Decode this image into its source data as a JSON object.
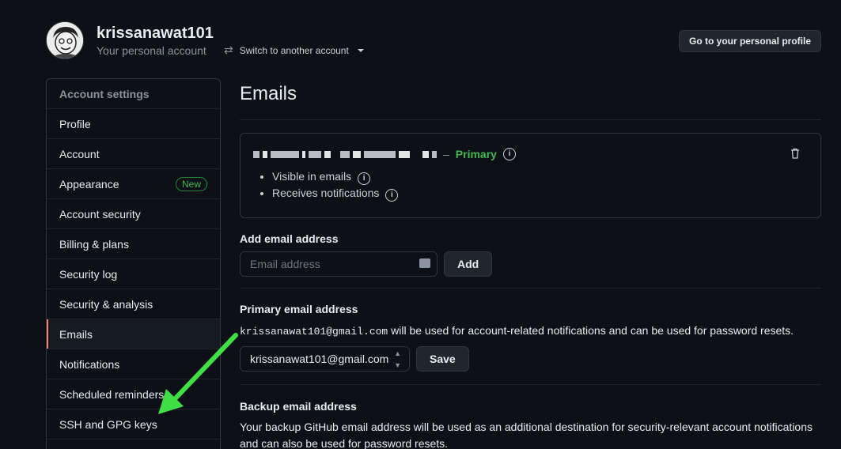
{
  "header": {
    "username": "krissanawat101",
    "subtitle": "Your personal account",
    "switch_label": "Switch to another account",
    "profile_button": "Go to your personal profile"
  },
  "sidebar": {
    "items": [
      {
        "label": "Account settings"
      },
      {
        "label": "Profile"
      },
      {
        "label": "Account"
      },
      {
        "label": "Appearance",
        "badge": "New"
      },
      {
        "label": "Account security"
      },
      {
        "label": "Billing & plans"
      },
      {
        "label": "Security log"
      },
      {
        "label": "Security & analysis"
      },
      {
        "label": "Emails"
      },
      {
        "label": "Notifications"
      },
      {
        "label": "Scheduled reminders"
      },
      {
        "label": "SSH and GPG keys"
      }
    ]
  },
  "main": {
    "title": "Emails",
    "email_card": {
      "separator": "–",
      "primary_label": "Primary",
      "bullets": [
        "Visible in emails",
        "Receives notifications"
      ]
    },
    "add_email": {
      "label": "Add email address",
      "placeholder": "Email address",
      "button": "Add"
    },
    "primary_email": {
      "label": "Primary email address",
      "email": "krissanawat101@gmail.com",
      "description": " will be used for account-related notifications and can be used for password resets.",
      "selected": "krissanawat101@gmail.com",
      "button": "Save"
    },
    "backup_email": {
      "label": "Backup email address",
      "description": "Your backup GitHub email address will be used as an additional destination for security-relevant account notifications and can also be used for password resets."
    }
  },
  "colors": {
    "background": "#0d1117",
    "border": "#30363d",
    "primary_green": "#3fb950",
    "active_marker": "#f78166",
    "arrow_green": "#3fe046"
  }
}
